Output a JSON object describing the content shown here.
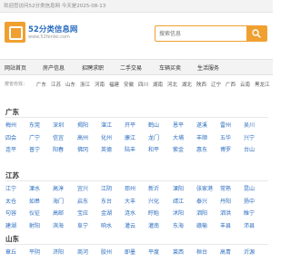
{
  "topbar": {
    "welcome": "欢迎您访问52分类信息网 今天是2025-08-13"
  },
  "logo": {
    "name": "52分类信息网",
    "domain": "www.52fenlei.com",
    "brand_color": "#f0a030"
  },
  "search": {
    "placeholder": "搜索信息",
    "icon": "search-icon"
  },
  "nav": {
    "items": [
      "网站首页",
      "房产信息",
      "招聘求职",
      "二手交易",
      "车辆买卖",
      "生活服务"
    ]
  },
  "provinces": {
    "label": "按省份找：",
    "items": [
      "广东",
      "江苏",
      "山东",
      "浙江",
      "河南",
      "福建",
      "安徽",
      "四川",
      "湖南",
      "河北",
      "湖北",
      "陕西",
      "辽宁",
      "广西",
      "云南",
      "黑龙江"
    ]
  },
  "blocks": [
    {
      "title": "广东",
      "rows": [
        [
          "梅州",
          "东莞",
          "深圳",
          "揭阳",
          "湛江",
          "开平",
          "鹤山",
          "恩平",
          "遂溪",
          "雷州",
          "吴川"
        ],
        [
          "四会",
          "广宁",
          "信宜",
          "高州",
          "化州",
          "廉江",
          "龙门",
          "大埔",
          "丰顺",
          "五华",
          "兴宁"
        ],
        [
          "连平",
          "普宁",
          "阳春",
          "佛冈",
          "英德",
          "陆丰",
          "和平",
          "紫金",
          "惠东",
          "博罗",
          "台山"
        ],
        [
          "",
          "",
          "",
          "",
          "",
          "",
          "",
          "",
          "",
          "",
          ""
        ]
      ]
    },
    {
      "title": "江苏",
      "rows": [
        [
          "江宁",
          "溧水",
          "高淳",
          "宜兴",
          "江阴",
          "邳州",
          "新沂",
          "溧阳",
          "张家港",
          "常熟",
          "昆山"
        ],
        [
          "太仓",
          "如皋",
          "海门",
          "启东",
          "东台",
          "大丰",
          "兴化",
          "靖江",
          "泰兴",
          "丹阳",
          "扬中"
        ],
        [
          "句容",
          "仪征",
          "高邮",
          "宝应",
          "金湖",
          "涟水",
          "盱眙",
          "沭阳",
          "泗阳",
          "泗洪",
          "睢宁"
        ],
        [
          "建湖",
          "射阳",
          "滨海",
          "阜宁",
          "响水",
          "灌云",
          "灌南",
          "东海",
          "赣榆",
          "丰县",
          "沛县"
        ]
      ]
    },
    {
      "title": "山东",
      "rows": [
        [
          "章丘",
          "平阴",
          "济阳",
          "商河",
          "胶州",
          "即墨",
          "平度",
          "莱西",
          "桓台",
          "高青",
          "沂源"
        ],
        [
          "",
          "",
          "",
          "",
          "",
          "",
          "",
          "",
          "",
          "",
          ""
        ]
      ]
    }
  ]
}
